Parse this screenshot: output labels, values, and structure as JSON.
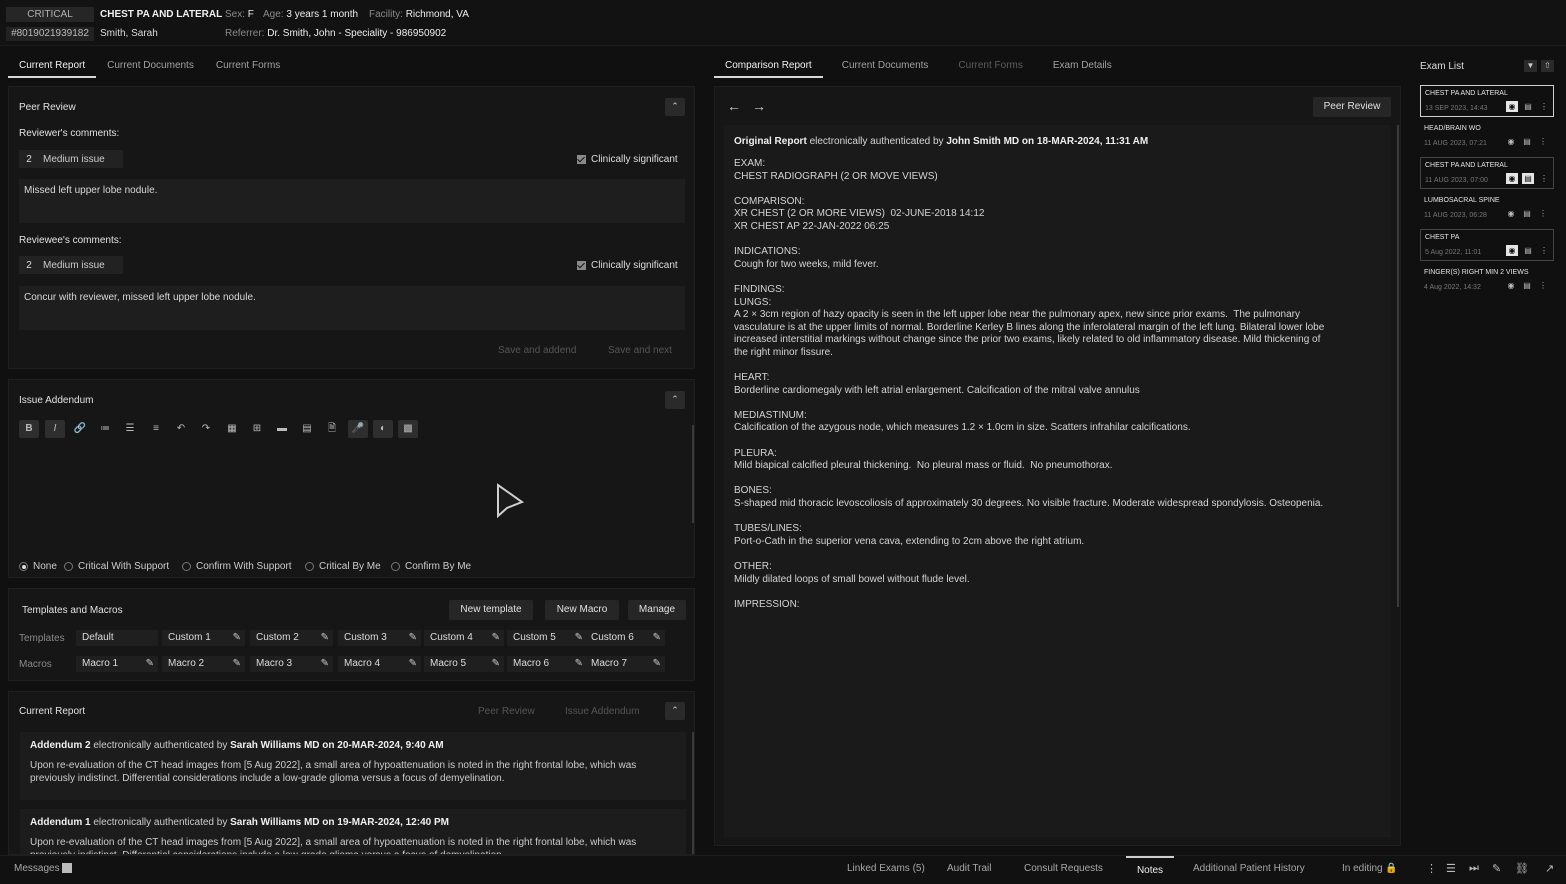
{
  "header": {
    "status": "CRITICAL",
    "exam": "CHEST PA AND LATERAL",
    "sex_label": "Sex:",
    "sex": "F",
    "age_label": "Age:",
    "age": "3 years 1 month",
    "facility_label": "Facility:",
    "facility": "Richmond, VA",
    "mrn": "#8019021939182",
    "patient": "Smith, Sarah",
    "referrer_label": "Referrer:",
    "referrer": "Dr. Smith, John - Speciality - 986950902"
  },
  "left_tabs": [
    "Current Report",
    "Current Documents",
    "Current Forms"
  ],
  "peer_review": {
    "title": "Peer Review",
    "reviewer": {
      "label": "Reviewer's comments:",
      "level": "2",
      "severity": "Medium issue",
      "flag": "Clinically significant",
      "comment": "Missed left upper lobe nodule."
    },
    "reviewee": {
      "label": "Reviewee's comments:",
      "level": "2",
      "severity": "Medium issue",
      "flag": "Clinically significant",
      "comment": "Concur with reviewer, missed left upper lobe nodule."
    },
    "save_addend": "Save and addend",
    "save_next": "Save and next"
  },
  "addendum": {
    "title": "Issue Addendum",
    "toolbar": [
      "B",
      "I",
      "🔗",
      "≔",
      "☰",
      "≡",
      "↶",
      "↷",
      "▦",
      "⊞",
      "▬",
      "▤",
      "🗎",
      "🎤",
      "◐",
      "▩"
    ],
    "options": [
      "None",
      "Critical With Support",
      "Confirm With Support",
      "Critical By Me",
      "Confirm By Me"
    ]
  },
  "templates": {
    "title": "Templates and Macros",
    "new_template": "New template",
    "new_macro": "New Macro",
    "manage": "Manage",
    "templates_label": "Templates",
    "macros_label": "Macros",
    "template_items": [
      "Default",
      "Custom 1",
      "Custom 2",
      "Custom 3",
      "Custom 4",
      "Custom 5",
      "Custom 6"
    ],
    "macro_items": [
      "Macro 1",
      "Macro 2",
      "Macro 3",
      "Macro 4",
      "Macro 5",
      "Macro 6",
      "Macro 7"
    ]
  },
  "current_report": {
    "title": "Current Report",
    "peer_review": "Peer Review",
    "issue_addendum": "Issue Addendum",
    "addenda": [
      {
        "name": "Addendum 2",
        "auth": "electronically authenticated by",
        "by": "Sarah Williams MD on 20-MAR-2024, 9:40 AM",
        "text": "Upon re-evaluation of the CT head images from [5 Aug 2022], a small area of hypoattenuation is noted in the right frontal lobe, which was previously indistinct. Differential considerations include a low-grade glioma versus a focus of demyelination."
      },
      {
        "name": "Addendum 1",
        "auth": "electronically authenticated by",
        "by": "Sarah Williams MD on 19-MAR-2024, 12:40 PM",
        "text": "Upon re-evaluation of the CT head images from [5 Aug 2022], a small area of hypoattenuation is noted in the right frontal lobe, which was previously indistinct. Differential considerations include a low-grade glioma versus a focus of demyelination."
      }
    ]
  },
  "mid_tabs": [
    "Comparison Report",
    "Current Documents",
    "Current Forms",
    "Exam Details"
  ],
  "comparison": {
    "peer_review_btn": "Peer Review",
    "original_label": "Original Report",
    "auth": "electronically authenticated by",
    "by": "John Smith MD on 18-MAR-2024, 11:31 AM",
    "body": "EXAM:\nCHEST RADIOGRAPH (2 OR MOVE VIEWS)\n\nCOMPARISON:\nXR CHEST (2 OR MORE VIEWS)  02-JUNE-2018 14:12\nXR CHEST AP 22-JAN-2022 06:25\n\nINDICATIONS:\nCough for two weeks, mild fever.\n\nFINDINGS:\nLUNGS:\nA 2 × 3cm region of hazy opacity is seen in the left upper lobe near the pulmonary apex, new since prior exams.  The pulmonary vasculature is at the upper limits of normal. Borderline Kerley B lines along the inferolateral margin of the left lung. Bilateral lower lobe increased interstitial markings without change since the prior two exams, likely related to old inflammatory disease. Mild thickening of the right minor fissure.\n\nHEART:\nBorderline cardiomegaly with left atrial enlargement. Calcification of the mitral valve annulus\n\nMEDIASTINUM:\nCalcification of the azygous node, which measures 1.2 × 1.0cm in size. Scatters infrahilar calcifications.\n\nPLEURA:\nMild biapical calcified pleural thickening.  No pleural mass or fluid.  No pneumothorax.\n\nBONES:\nS-shaped mid thoracic levoscoliosis of approximately 30 degrees. No visible fracture. Moderate widespread spondylosis. Osteopenia.\n\nTUBES/LINES:\nPort-o-Cath in the superior vena cava, extending to 2cm above the right atrium.\n\nOTHER:\nMildly dilated loops of small bowel without flude level.\n\nIMPRESSION:"
  },
  "exam_list": {
    "title": "Exam List",
    "items": [
      {
        "name": "CHEST PA AND LATERAL",
        "date": "13 SEP 2023, 14:43"
      },
      {
        "name": "HEAD/BRAIN WO",
        "date": "11 AUG 2023, 07:21"
      },
      {
        "name": "CHEST PA AND LATERAL",
        "date": "11 AUG 2023, 07:00"
      },
      {
        "name": "LUMBOSACRAL SPINE",
        "date": "11 AUG 2023, 06:28"
      },
      {
        "name": "CHEST PA",
        "date": "5 Aug 2022, 11:01"
      },
      {
        "name": "FINGER(S) RIGHT MIN 2 VIEWS",
        "date": "4 Aug 2022, 14:32"
      }
    ]
  },
  "footer": {
    "messages": "Messages",
    "linked": "Linked Exams (5)",
    "audit": "Audit Trail",
    "consult": "Consult Requests",
    "notes": "Notes",
    "history": "Additional Patient History",
    "editing": "In editing"
  }
}
